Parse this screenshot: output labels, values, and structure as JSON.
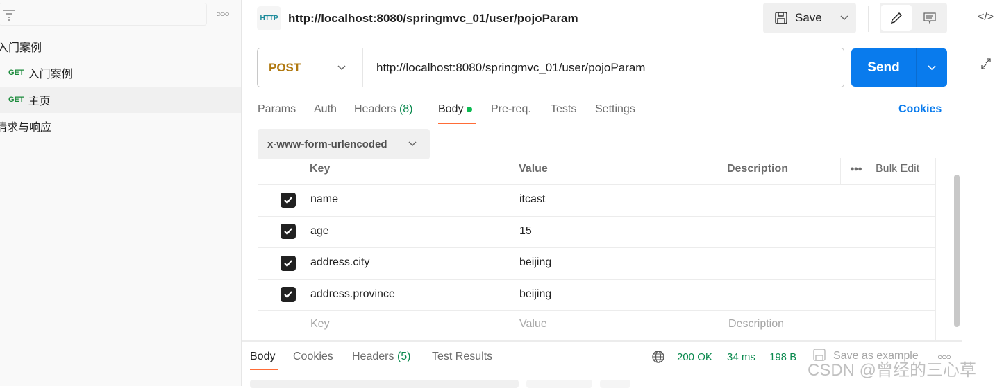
{
  "sidebar": {
    "more_icon": "more-horizontal-icon",
    "items": [
      {
        "label": "入门案例",
        "type": "folder"
      },
      {
        "method": "GET",
        "label": "入门案例"
      },
      {
        "method": "GET",
        "label": "主页",
        "selected": true
      },
      {
        "label": "请求与响应",
        "type": "folder"
      }
    ]
  },
  "header": {
    "title": "http://localhost:8080/springmvc_01/user/pojoParam",
    "icon_text": "HTTP",
    "save_label": "Save"
  },
  "request": {
    "method": "POST",
    "url": "http://localhost:8080/springmvc_01/user/pojoParam",
    "send_label": "Send",
    "method_color": "#b0780f",
    "send_color": "#097bed"
  },
  "tabs": {
    "params": "Params",
    "auth": "Auth",
    "headers": "Headers",
    "headers_count": "(8)",
    "body": "Body",
    "prereq": "Pre-req.",
    "tests": "Tests",
    "settings": "Settings",
    "cookies": "Cookies",
    "active": "Body"
  },
  "body_type": "x-www-form-urlencoded",
  "table": {
    "headers": {
      "key": "Key",
      "value": "Value",
      "description": "Description",
      "bulk_edit": "Bulk Edit"
    },
    "rows": [
      {
        "checked": true,
        "key": "name",
        "value": "itcast"
      },
      {
        "checked": true,
        "key": "age",
        "value": "15"
      },
      {
        "checked": true,
        "key": "address.city",
        "value": "beijing"
      },
      {
        "checked": true,
        "key": "address.province",
        "value": "beijing"
      }
    ],
    "placeholders": {
      "key": "Key",
      "value": "Value",
      "description": "Description"
    }
  },
  "response": {
    "tabs": {
      "body": "Body",
      "cookies": "Cookies",
      "headers": "Headers",
      "headers_count": "(5)",
      "test_results": "Test Results"
    },
    "status": "200 OK",
    "time": "34 ms",
    "size": "198 B",
    "save_example": "Save as example"
  },
  "watermark": "CSDN @曾经的三心草"
}
